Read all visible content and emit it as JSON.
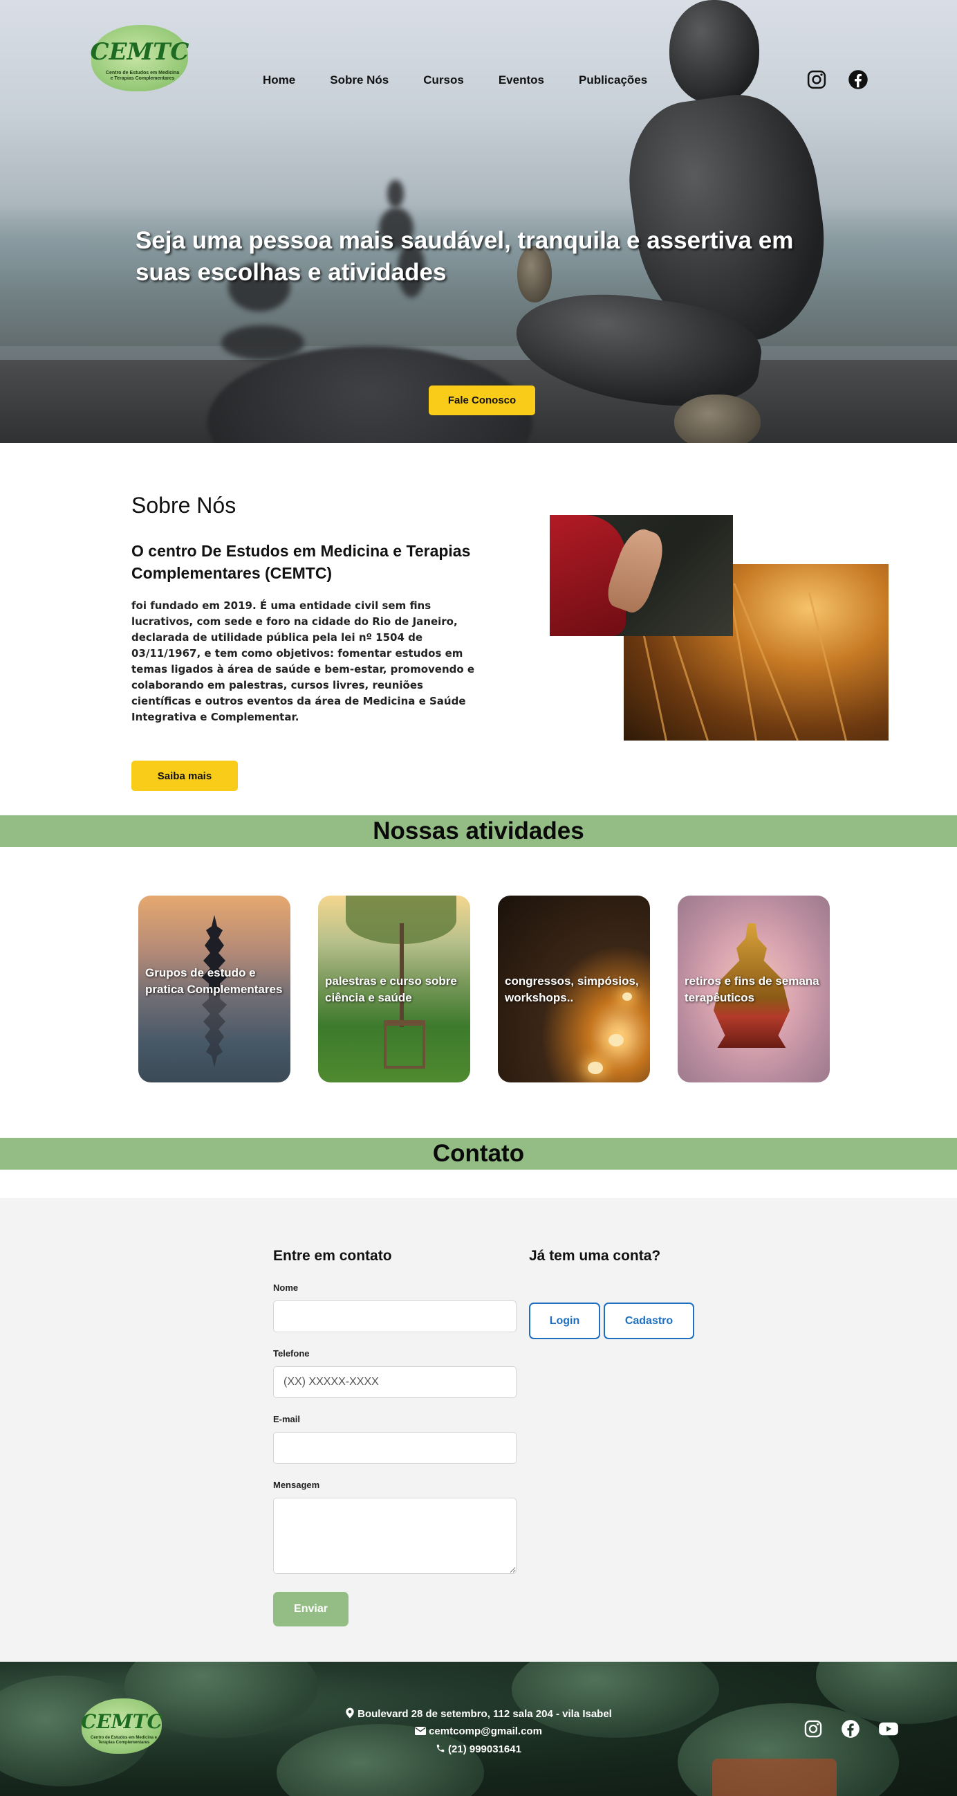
{
  "brand": {
    "logo_text": "CEMTC",
    "logo_subtitle": "Centro de Estudos em Medicina e Terapias Complementares"
  },
  "nav": {
    "items": [
      {
        "label": "Home"
      },
      {
        "label": "Sobre Nós"
      },
      {
        "label": "Cursos"
      },
      {
        "label": "Eventos"
      },
      {
        "label": "Publicações"
      }
    ],
    "social": [
      "instagram-icon",
      "facebook-icon"
    ]
  },
  "hero": {
    "title": "Seja uma pessoa mais saudável, tranquila e assertiva em suas escolhas e atividades",
    "cta_label": "Fale Conosco"
  },
  "about": {
    "heading": "Sobre Nós",
    "subheading": "O centro De Estudos em Medicina e Terapias Complementares (CEMTC)",
    "body": "foi fundado em 2019. É uma entidade civil sem fins lucrativos, com sede e foro na cidade do Rio de Janeiro, declarada de utilidade pública pela lei nº 1504 de 03/11/1967, e tem como objetivos: fomentar estudos em temas ligados à área de saúde e bem-estar, promovendo e colaborando em palestras, cursos livres, reuniões científicas e outros eventos da área de Medicina e Saúde Integrativa e Complementar.",
    "cta_label": "Saiba mais"
  },
  "activities": {
    "heading": "Nossas atividades",
    "cards": [
      {
        "label": "Grupos de estudo e pratica Complementares"
      },
      {
        "label": "palestras e curso sobre ciência e saúde"
      },
      {
        "label": "congressos, simpósios, workshops.."
      },
      {
        "label": "retiros e fins de semana terapêuticos"
      }
    ]
  },
  "contact": {
    "heading": "Contato",
    "form_title": "Entre em contato",
    "fields": {
      "name_label": "Nome",
      "name_value": "",
      "phone_label": "Telefone",
      "phone_placeholder": "(XX) XXXXX-XXXX",
      "email_label": "E-mail",
      "email_value": "",
      "message_label": "Mensagem",
      "message_value": ""
    },
    "submit_label": "Enviar",
    "account_title": "Já tem uma conta?",
    "login_label": "Login",
    "signup_label": "Cadastro"
  },
  "footer": {
    "address": "Boulevard 28 de setembro, 112 sala 204 - vila Isabel",
    "email": "cemtcomp@gmail.com",
    "phone": "(21) 999031641",
    "social": [
      "instagram-icon",
      "facebook-icon",
      "youtube-icon"
    ]
  },
  "colors": {
    "accent_yellow": "#f9cc1a",
    "band_green": "#93bd84",
    "link_blue": "#1f6fc0",
    "contact_bg": "#f3f3f3"
  }
}
